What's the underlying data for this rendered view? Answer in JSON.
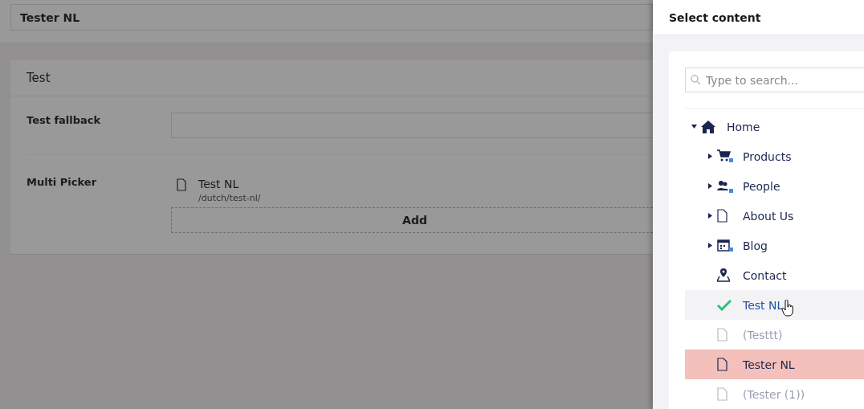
{
  "editor": {
    "name_field": {
      "value": "Tester NL"
    },
    "group": {
      "title": "Test",
      "properties": [
        {
          "kind": "text",
          "label": "Test fallback"
        },
        {
          "kind": "picker",
          "label": "Multi Picker",
          "items": [
            {
              "name": "Test NL",
              "path": "/dutch/test-nl/"
            }
          ],
          "add_label": "Add"
        }
      ]
    }
  },
  "dialog": {
    "title": "Select content",
    "search": {
      "placeholder": "Type to search..."
    },
    "tree": [
      {
        "name": "Home",
        "kind": "home",
        "expanded": true,
        "selected": false,
        "disabled": false,
        "current": false,
        "children": [
          {
            "name": "Products",
            "kind": "cart",
            "expanded": false,
            "selected": false,
            "disabled": false,
            "current": false
          },
          {
            "name": "People",
            "kind": "people",
            "expanded": false,
            "selected": false,
            "disabled": false,
            "current": false
          },
          {
            "name": "About Us",
            "kind": "document",
            "expanded": false,
            "selected": false,
            "disabled": false,
            "current": false
          },
          {
            "name": "Blog",
            "kind": "calendar",
            "expanded": false,
            "selected": false,
            "disabled": false,
            "current": false
          },
          {
            "name": "Contact",
            "kind": "pin",
            "selected": false,
            "disabled": false,
            "current": false
          },
          {
            "name": "Test NL",
            "selected": true,
            "disabled": false,
            "current": false
          },
          {
            "name": "(Testtt)",
            "kind": "document",
            "selected": false,
            "disabled": true,
            "current": false
          },
          {
            "name": "Tester NL",
            "kind": "document",
            "selected": false,
            "disabled": false,
            "current": true
          },
          {
            "name": "(Tester (1))",
            "kind": "document",
            "selected": false,
            "disabled": true,
            "current": false
          }
        ]
      }
    ]
  }
}
